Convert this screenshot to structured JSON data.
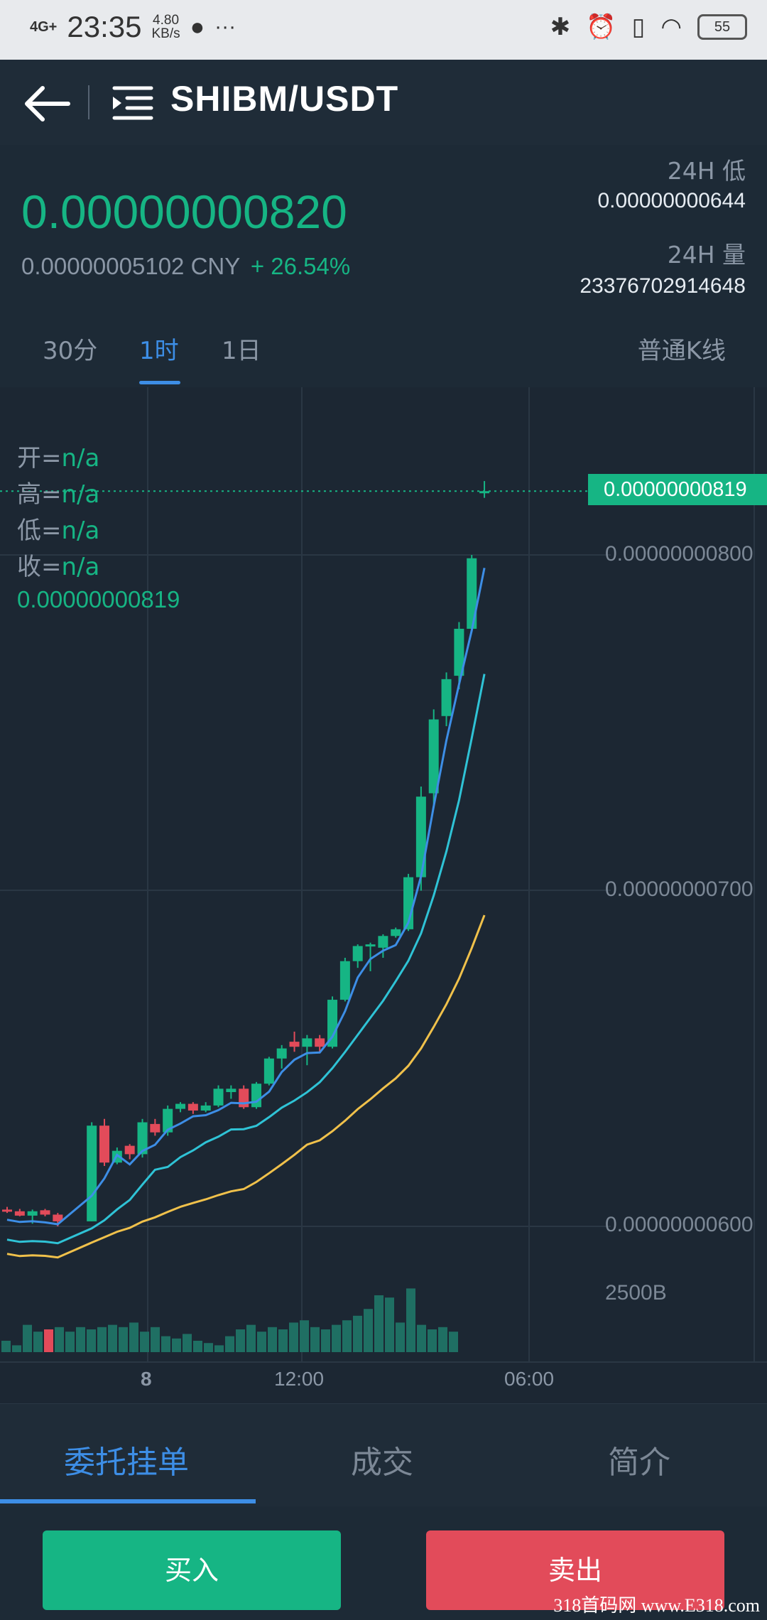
{
  "status_bar": {
    "network": "4G+",
    "time": "23:35",
    "speed": "4.80",
    "speed_unit": "KB/s",
    "more": "···",
    "battery": "55"
  },
  "header": {
    "pair": "SHIBM/USDT"
  },
  "ticker": {
    "last_price": "0.00000000820",
    "cny_price": "0.00000005102 CNY",
    "change": "+ 26.54%",
    "low_label": "24H 低",
    "low_value": "0.00000000644",
    "volume_label": "24H 量",
    "volume_value": "23376702914648"
  },
  "intervals": [
    {
      "label": "30分",
      "active": false
    },
    {
      "label": "1时",
      "active": true
    },
    {
      "label": "1日",
      "active": false
    }
  ],
  "kline_type": "普通K线",
  "ohlc": {
    "open_label": "开=",
    "open_value": "n/a",
    "high_label": "高=",
    "high_value": "n/a",
    "low_label": "低=",
    "low_value": "n/a",
    "close_label": "收=",
    "close_value": "n/a",
    "price": "0.00000000819"
  },
  "chart_data": {
    "type": "candlestick",
    "current_price_tag": "0.00000000819",
    "y_tick_labels": [
      "0.00000000800",
      "0.00000000700",
      "0.00000000600"
    ],
    "volume_tick_label": "2500B",
    "x_tick_labels": [
      "8",
      "12:00",
      "06:00"
    ],
    "colors": {
      "up": "#16b584",
      "down": "#e24b5a",
      "ma_fast": "#3d8ee6",
      "ma_mid": "#2fc3d6",
      "ma_slow": "#f0c14b",
      "grid": "#2a3744"
    },
    "candles": [
      {
        "o": 6.05,
        "h": 6.058,
        "l": 6.04,
        "c": 6.045
      },
      {
        "o": 6.045,
        "h": 6.052,
        "l": 6.03,
        "c": 6.032
      },
      {
        "o": 6.032,
        "h": 6.05,
        "l": 6.008,
        "c": 6.045
      },
      {
        "o": 6.048,
        "h": 6.052,
        "l": 6.03,
        "c": 6.035
      },
      {
        "o": 6.035,
        "h": 6.04,
        "l": 6.0,
        "c": 6.015
      },
      {
        "o": 6.015,
        "h": 6.31,
        "l": 6.015,
        "c": 6.3
      },
      {
        "o": 6.3,
        "h": 6.32,
        "l": 6.18,
        "c": 6.19
      },
      {
        "o": 6.19,
        "h": 6.235,
        "l": 6.185,
        "c": 6.225
      },
      {
        "o": 6.24,
        "h": 6.245,
        "l": 6.2,
        "c": 6.215
      },
      {
        "o": 6.215,
        "h": 6.32,
        "l": 6.205,
        "c": 6.31
      },
      {
        "o": 6.305,
        "h": 6.32,
        "l": 6.27,
        "c": 6.28
      },
      {
        "o": 6.28,
        "h": 6.36,
        "l": 6.27,
        "c": 6.35
      },
      {
        "o": 6.35,
        "h": 6.37,
        "l": 6.34,
        "c": 6.365
      },
      {
        "o": 6.365,
        "h": 6.37,
        "l": 6.335,
        "c": 6.345
      },
      {
        "o": 6.345,
        "h": 6.37,
        "l": 6.34,
        "c": 6.36
      },
      {
        "o": 6.36,
        "h": 6.42,
        "l": 6.355,
        "c": 6.41
      },
      {
        "o": 6.4,
        "h": 6.42,
        "l": 6.38,
        "c": 6.41
      },
      {
        "o": 6.41,
        "h": 6.42,
        "l": 6.35,
        "c": 6.355
      },
      {
        "o": 6.355,
        "h": 6.43,
        "l": 6.35,
        "c": 6.425
      },
      {
        "o": 6.425,
        "h": 6.505,
        "l": 6.42,
        "c": 6.5
      },
      {
        "o": 6.5,
        "h": 6.54,
        "l": 6.47,
        "c": 6.53
      },
      {
        "o": 6.55,
        "h": 6.58,
        "l": 6.52,
        "c": 6.535
      },
      {
        "o": 6.535,
        "h": 6.57,
        "l": 6.48,
        "c": 6.56
      },
      {
        "o": 6.56,
        "h": 6.57,
        "l": 6.52,
        "c": 6.535
      },
      {
        "o": 6.535,
        "h": 6.685,
        "l": 6.53,
        "c": 6.675
      },
      {
        "o": 6.675,
        "h": 6.8,
        "l": 6.67,
        "c": 6.79
      },
      {
        "o": 6.79,
        "h": 6.84,
        "l": 6.77,
        "c": 6.835
      },
      {
        "o": 6.835,
        "h": 6.845,
        "l": 6.76,
        "c": 6.84
      },
      {
        "o": 6.83,
        "h": 6.87,
        "l": 6.8,
        "c": 6.865
      },
      {
        "o": 6.865,
        "h": 6.89,
        "l": 6.86,
        "c": 6.885
      },
      {
        "o": 6.885,
        "h": 7.05,
        "l": 6.88,
        "c": 7.04
      },
      {
        "o": 7.04,
        "h": 7.31,
        "l": 7.0,
        "c": 7.28
      },
      {
        "o": 7.29,
        "h": 7.54,
        "l": 7.25,
        "c": 7.51
      },
      {
        "o": 7.52,
        "h": 7.65,
        "l": 7.49,
        "c": 7.63
      },
      {
        "o": 7.64,
        "h": 7.8,
        "l": 7.6,
        "c": 7.78
      },
      {
        "o": 7.78,
        "h": 8.0,
        "l": 7.77,
        "c": 7.99
      },
      {
        "o": 8.185,
        "h": 8.22,
        "l": 8.17,
        "c": 8.19
      }
    ],
    "volumes": [
      5,
      3,
      12,
      9,
      10,
      11,
      9,
      11,
      10,
      11,
      12,
      11,
      13,
      9,
      11,
      7,
      6,
      8,
      5,
      4,
      3,
      7,
      10,
      12,
      9,
      11,
      10,
      13,
      14,
      11,
      10,
      12,
      14,
      16,
      19,
      25,
      24,
      13,
      28,
      12,
      10,
      11,
      9
    ],
    "volume_colors": [
      "up",
      "up",
      "up",
      "up",
      "down",
      "up",
      "up",
      "up",
      "up",
      "up",
      "up",
      "up",
      "up",
      "up",
      "up",
      "up",
      "up",
      "up",
      "up",
      "up",
      "up",
      "up",
      "up",
      "up",
      "up",
      "up",
      "up",
      "up",
      "up",
      "up",
      "up",
      "up",
      "up",
      "up",
      "up",
      "up",
      "up",
      "up",
      "up",
      "up",
      "up",
      "up",
      "up"
    ]
  },
  "bottom_tabs": [
    {
      "label": "委托挂单",
      "active": true
    },
    {
      "label": "成交",
      "active": false
    },
    {
      "label": "简介",
      "active": false
    }
  ],
  "actions": {
    "buy": "买入",
    "sell": "卖出"
  },
  "watermark": "318首码网 www.E318.com"
}
